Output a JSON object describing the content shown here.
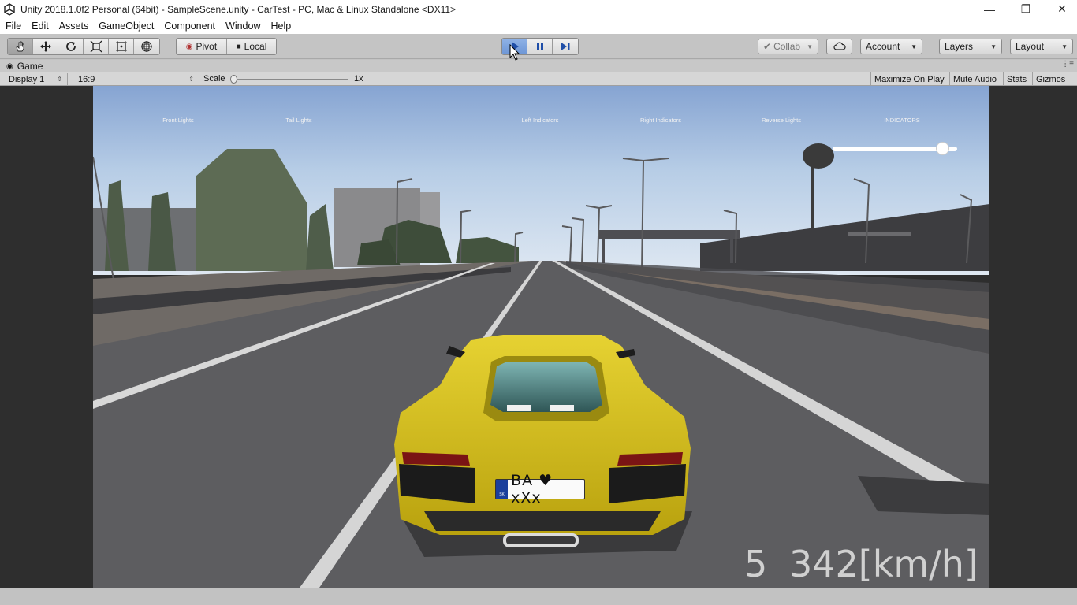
{
  "window": {
    "title": "Unity 2018.1.0f2 Personal (64bit) - SampleScene.unity - CarTest - PC, Mac & Linux Standalone <DX11>",
    "controls": {
      "minimize": "—",
      "maximize": "❐",
      "close": "✕"
    }
  },
  "menu": [
    "File",
    "Edit",
    "Assets",
    "GameObject",
    "Component",
    "Window",
    "Help"
  ],
  "toolbar": {
    "tools": [
      "hand-icon",
      "move-icon",
      "rotate-icon",
      "scale-icon",
      "rect-tool-icon",
      "transform-tool-icon"
    ],
    "pivot": "Pivot",
    "local": "Local",
    "collab": "Collab",
    "account": "Account",
    "layers": "Layers",
    "layout": "Layout"
  },
  "game_tab": {
    "label": "Game"
  },
  "game_toolbar": {
    "display": "Display 1",
    "aspect": "16:9",
    "scale_label": "Scale",
    "scale_value": "1x",
    "maximize_on_play": "Maximize On Play",
    "mute_audio": "Mute Audio",
    "stats": "Stats",
    "gizmos": "Gizmos"
  },
  "hud": {
    "buttons": [
      "Front Lights",
      "Tail Lights",
      "Left Indicators",
      "Right Indicators",
      "Reverse Lights",
      "INDICATORS"
    ],
    "slider_value": 0.88,
    "gear": "5",
    "speed": "342[km/h]",
    "plate_text": "BA ♥ xXx",
    "plate_country": "SK"
  },
  "colors": {
    "car_body": "#d8c21c",
    "sky_top": "#8aa8d4",
    "road": "#5a5a5c",
    "play_active": "#6d96d6"
  }
}
